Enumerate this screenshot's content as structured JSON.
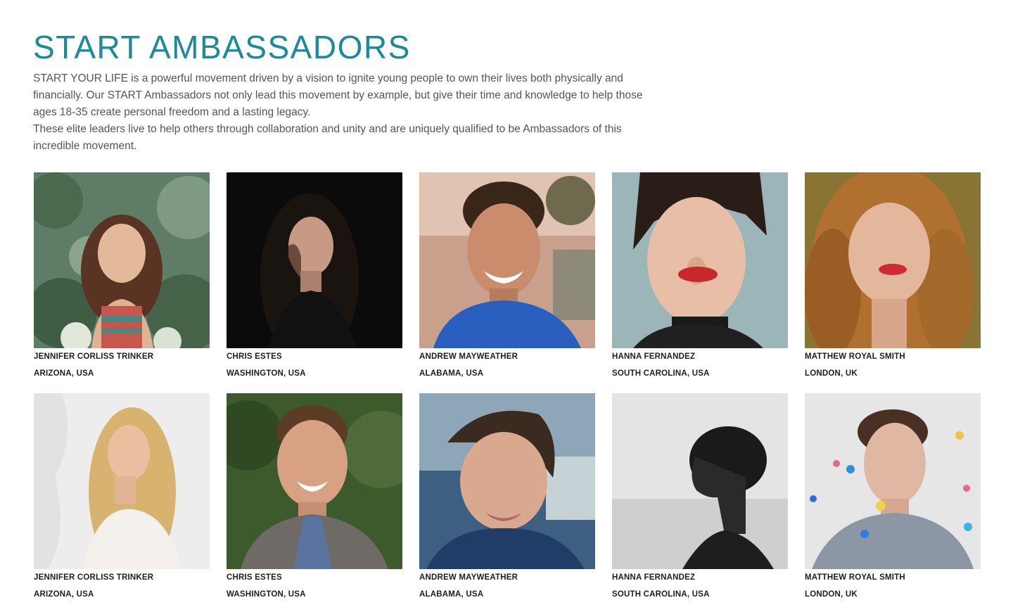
{
  "header": {
    "title": "START AMBASSADORS"
  },
  "intro": {
    "paragraph_1": "START YOUR LIFE is a powerful movement driven by a vision to ignite young people to own their lives both physically and financially. Our START Ambassadors not only lead this movement by example, but give their time and knowledge to help those ages 18-35 create personal freedom and a lasting legacy.",
    "paragraph_2": "These elite leaders live to help others through collaboration and unity and are uniquely qualified to be Ambassadors of this incredible movement."
  },
  "ambassadors": [
    {
      "name": "JENNIFER CORLISS TRINKER",
      "location": "ARIZONA, USA"
    },
    {
      "name": "CHRIS ESTES",
      "location": "WASHINGTON, USA"
    },
    {
      "name": "ANDREW MAYWEATHER",
      "location": "ALABAMA, USA"
    },
    {
      "name": "HANNA FERNANDEZ",
      "location": "SOUTH CAROLINA, USA"
    },
    {
      "name": "MATTHEW ROYAL SMITH",
      "location": "LONDON, UK"
    },
    {
      "name": "JENNIFER CORLISS TRINKER",
      "location": "ARIZONA, USA"
    },
    {
      "name": "CHRIS ESTES",
      "location": "WASHINGTON, USA"
    },
    {
      "name": "ANDREW MAYWEATHER",
      "location": "ALABAMA, USA"
    },
    {
      "name": "HANNA FERNANDEZ",
      "location": "SOUTH CAROLINA, USA"
    },
    {
      "name": "MATTHEW ROYAL SMITH",
      "location": "LONDON, UK"
    }
  ],
  "colors": {
    "title": "#1b8a9a",
    "body_text": "#555555",
    "caption_text": "#1e1e1e",
    "background": "#ffffff"
  }
}
